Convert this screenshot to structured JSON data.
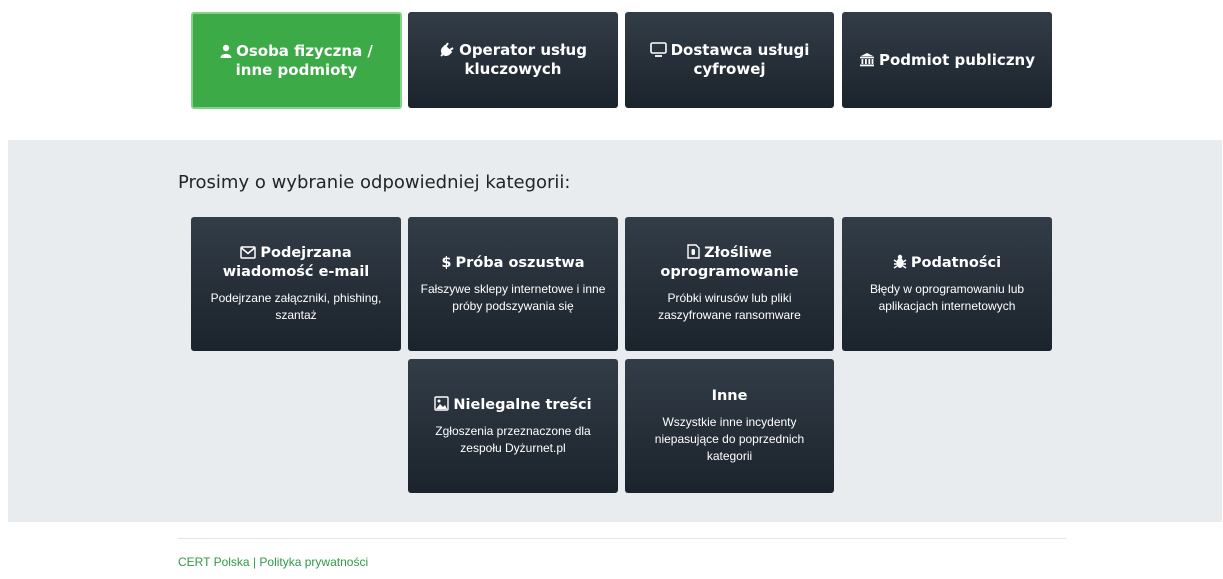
{
  "tabs": [
    {
      "label": "Osoba fizyczna / inne podmioty",
      "icon": "user-icon",
      "active": true
    },
    {
      "label": "Operator usług kluczowych",
      "icon": "plug-icon",
      "active": false
    },
    {
      "label": "Dostawca usługi cyfrowej",
      "icon": "monitor-icon",
      "active": false
    },
    {
      "label": "Podmiot publiczny",
      "icon": "institution-icon",
      "active": false
    }
  ],
  "heading": "Prosimy o wybranie odpowiedniej kategorii:",
  "categories": [
    {
      "title": "Podejrzana wiadomość e-mail",
      "icon": "envelope-icon",
      "description": "Podejrzane załączniki, phishing, szantaż"
    },
    {
      "title": "Próba oszustwa",
      "icon": "dollar-icon",
      "description": "Fałszywe sklepy internetowe i inne próby podszywania się"
    },
    {
      "title": "Złośliwe oprogramowanie",
      "icon": "malware-file-icon",
      "description": "Próbki wirusów lub pliki zaszyfrowane ransomware"
    },
    {
      "title": "Podatności",
      "icon": "bug-icon",
      "description": "Błędy w oprogramowaniu lub aplikacjach internetowych"
    },
    {
      "title": "Nielegalne treści",
      "icon": "image-icon",
      "description": "Zgłoszenia przeznaczone dla zespołu Dyżurnet.pl"
    },
    {
      "title": "Inne",
      "icon": "",
      "description": "Wszystkie inne incydenty niepasujące do poprzednich kategorii"
    }
  ],
  "footer": {
    "cert": "CERT Polska",
    "separator": "|",
    "privacy": "Polityka prywatności"
  },
  "colors": {
    "active_tab": "#3daa48",
    "tile_dark": "#232b34",
    "band": "#e9ecee",
    "footer_link": "#2f9a44"
  }
}
